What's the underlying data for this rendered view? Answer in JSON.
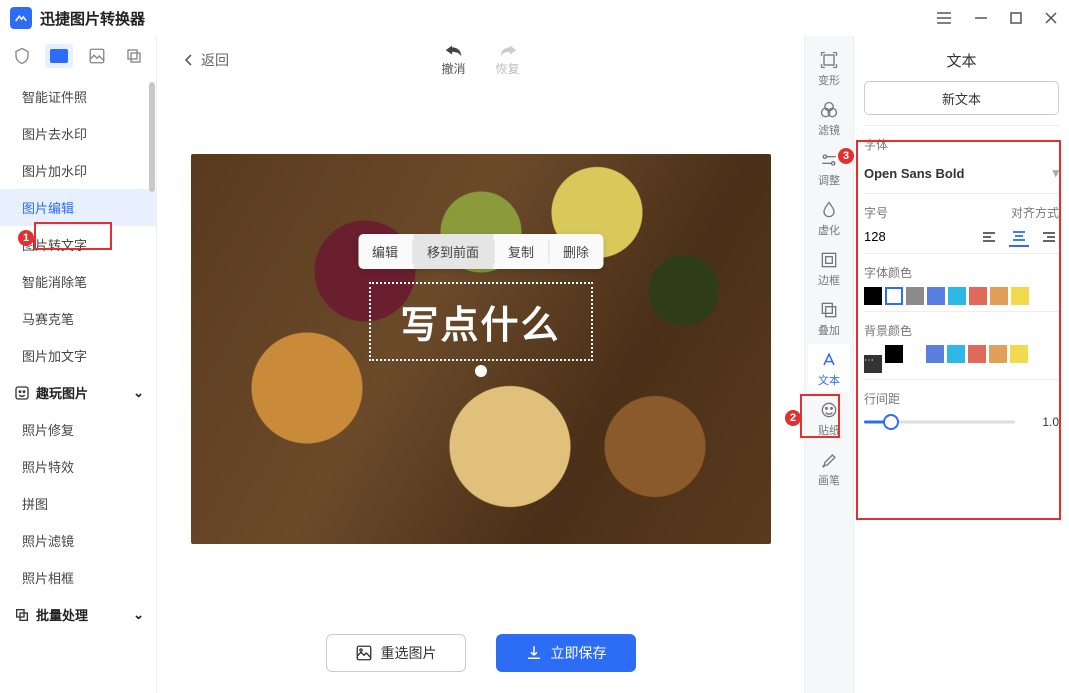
{
  "app": {
    "title": "迅捷图片转换器"
  },
  "window_controls": {
    "menu": "menu",
    "min": "min",
    "max": "max",
    "close": "close"
  },
  "sidebar": {
    "items": [
      {
        "label": "智能证件照"
      },
      {
        "label": "图片去水印"
      },
      {
        "label": "图片加水印"
      },
      {
        "label": "图片编辑",
        "active": true
      },
      {
        "label": "图片转文字"
      },
      {
        "label": "智能消除笔"
      },
      {
        "label": "马赛克笔"
      },
      {
        "label": "图片加文字"
      }
    ],
    "section_fun": "趣玩图片",
    "fun_items": [
      {
        "label": "照片修复"
      },
      {
        "label": "照片特效"
      },
      {
        "label": "拼图"
      },
      {
        "label": "照片滤镜"
      },
      {
        "label": "照片相框"
      }
    ],
    "section_batch": "批量处理"
  },
  "topbar": {
    "back": "返回",
    "undo": "撤消",
    "redo": "恢复"
  },
  "mini_toolbar": {
    "edit": "编辑",
    "to_front": "移到前面",
    "copy": "复制",
    "delete": "删除"
  },
  "canvas": {
    "text_placeholder": "写点什么"
  },
  "bottom": {
    "reselect": "重选图片",
    "save": "立即保存"
  },
  "toolstrip": {
    "transform": "变形",
    "filter": "滤镜",
    "adjust": "调整",
    "blur": "虚化",
    "border": "边框",
    "overlay": "叠加",
    "text": "文本",
    "sticker": "贴纸",
    "brush": "画笔"
  },
  "panel": {
    "title": "文本",
    "new_text": "新文本",
    "font_label": "字体",
    "font_value": "Open Sans Bold",
    "size_label": "字号",
    "align_label": "对齐方式",
    "size_value": "128",
    "font_color_label": "字体颜色",
    "font_colors": [
      "#000000",
      "#ffffff",
      "#8b8b8b",
      "#5a7fe0",
      "#2fb8e6",
      "#e06a5a",
      "#e0a05a",
      "#f2d94e"
    ],
    "font_color_selected_index": 1,
    "bg_color_label": "背景颜色",
    "bg_colors_left": [
      "transparent",
      "#000000"
    ],
    "bg_colors_right": [
      "#5a7fe0",
      "#2fb8e6",
      "#e06a5a",
      "#e0a05a",
      "#f2d94e"
    ],
    "line_height_label": "行间距",
    "line_height_value": "1.0",
    "line_height_pct": 18
  },
  "markers": {
    "m1": "1",
    "m2": "2",
    "m3": "3"
  }
}
